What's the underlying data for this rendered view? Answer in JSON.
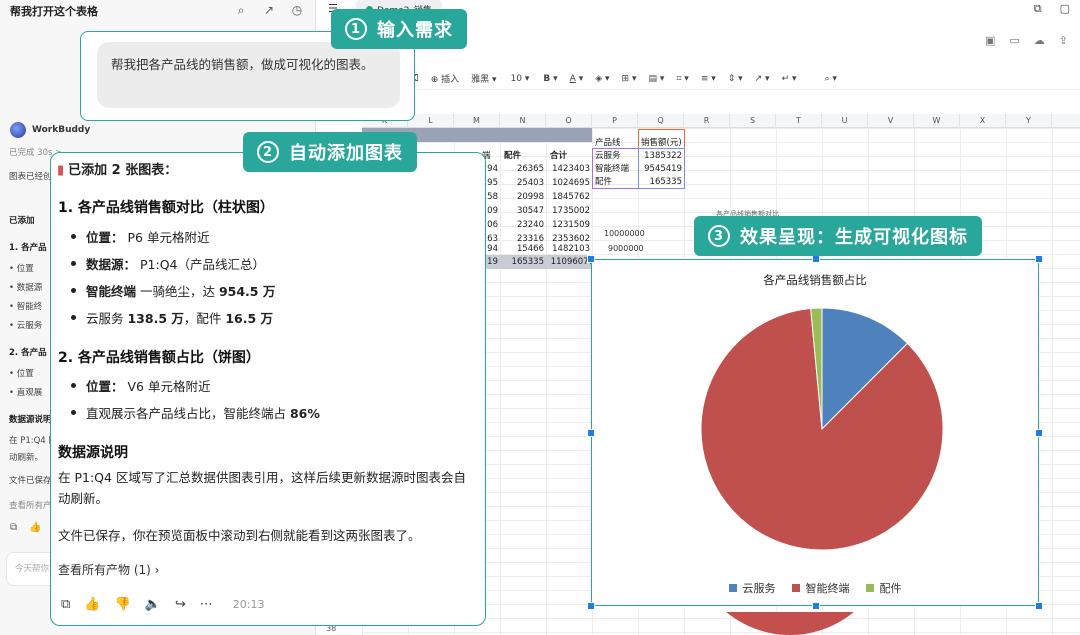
{
  "chat": {
    "title": "帮我打开这个表格",
    "subtitle": "",
    "agent_name": "WorkBuddy",
    "bg_lines": [
      {
        "text": "已完成 30s >",
        "top": 0
      },
      {
        "text": "图表已经创建",
        "top": 0
      },
      {
        "text": "已添加",
        "top": 0
      },
      {
        "text": "1. 各产品",
        "top": 0
      },
      {
        "text": "• 位置",
        "top": 0
      },
      {
        "text": "• 数据源",
        "top": 0
      },
      {
        "text": "• 智能终",
        "top": 0
      },
      {
        "text": "• 云服务",
        "top": 0
      },
      {
        "text": "2. 各产品",
        "top": 0
      },
      {
        "text": "• 位置",
        "top": 0
      },
      {
        "text": "• 直观展",
        "top": 0
      },
      {
        "text": "数据源说明",
        "top": 0
      },
      {
        "text": "在 P1:Q4 区",
        "top": 0
      },
      {
        "text": "动刷新。",
        "top": 0
      },
      {
        "text": "文件已保存",
        "top": 0
      },
      {
        "text": "查看所有产",
        "top": 0
      }
    ],
    "input_placeholder": "今天帮你"
  },
  "app": {
    "doc_tab": "Demo2_销售",
    "toolbar": {
      "insert": "插入",
      "font": "雅黑",
      "size": "10",
      "bold": "B"
    },
    "columns": [
      "K",
      "L",
      "M",
      "N",
      "O",
      "P",
      "Q",
      "R",
      "S",
      "T",
      "U",
      "V",
      "W",
      "X",
      "Y"
    ],
    "table_headers": {
      "n": "配件",
      "o": "合计",
      "m": "端"
    },
    "rows": [
      {
        "m": "94",
        "n": "26365",
        "o": "1423403"
      },
      {
        "m": "95",
        "n": "25403",
        "o": "1024695"
      },
      {
        "m": "58",
        "n": "20998",
        "o": "1845762"
      },
      {
        "m": "09",
        "n": "30547",
        "o": "1735002"
      },
      {
        "m": "06",
        "n": "23240",
        "o": "1231509"
      },
      {
        "m": "63",
        "n": "23316",
        "o": "2353602"
      },
      {
        "m": "94",
        "n": "15466",
        "o": "1482103"
      },
      {
        "m": "19",
        "n": "165335",
        "o": "11096077"
      }
    ],
    "summary": {
      "header_product": "产品线",
      "header_sales": "销售额(元)",
      "items": [
        {
          "name": "云服务",
          "value": "1385322"
        },
        {
          "name": "智能终端",
          "value": "9545419"
        },
        {
          "name": "配件",
          "value": "165335"
        }
      ]
    },
    "hidden_chart_title": "各产品线销售额对比",
    "axis_values": [
      "10000000",
      "9000000"
    ],
    "row_label": "38"
  },
  "request": {
    "text": "帮我把各产品线的销售额，做成可视化的图表。"
  },
  "callouts": {
    "c1_num": "1",
    "c1_text": "输入需求",
    "c2_num": "2",
    "c2_text": "自动添加图表",
    "c3_num": "3",
    "c3_text": "效果呈现：生成可视化图标"
  },
  "response": {
    "head": "已添加 2 张图表：",
    "s1_title": "1. 各产品线销售额对比（柱状图）",
    "s1_b1_label": "位置：",
    "s1_b1_value": " P6 单元格附近",
    "s1_b2_label": "数据源：",
    "s1_b2_value": " P1:Q4（产品线汇总）",
    "s1_b3_bold": "智能终端",
    "s1_b3_rest": " 一骑绝尘，达 ",
    "s1_b3_num": "954.5 万",
    "s1_b4_pre": "云服务 ",
    "s1_b4_num1": "138.5 万",
    "s1_b4_mid": "，配件 ",
    "s1_b4_num2": "16.5 万",
    "s2_title": "2. 各产品线销售额占比（饼图）",
    "s2_b1_label": "位置：",
    "s2_b1_value": " V6 单元格附近",
    "s2_b2_pre": "直观展示各产品线占比，智能终端占 ",
    "s2_b2_num": "86%",
    "s3_title": "数据源说明",
    "p1": "在 P1:Q4 区域写了汇总数据供图表引用，这样后续更新数据源时图表会自动刷新。",
    "p2": "文件已保存，你在预览面板中滚动到右侧就能看到这两张图表了。",
    "view_all": "查看所有产物 (1) ›",
    "time": "20:13"
  },
  "chart_data": {
    "type": "pie",
    "title": "各产品线销售额占比",
    "categories": [
      "云服务",
      "智能终端",
      "配件"
    ],
    "values": [
      1385322,
      9545419,
      165335
    ],
    "colors": [
      "#4f81bd",
      "#c0504d",
      "#9bbb59"
    ],
    "legend": "bottom"
  }
}
